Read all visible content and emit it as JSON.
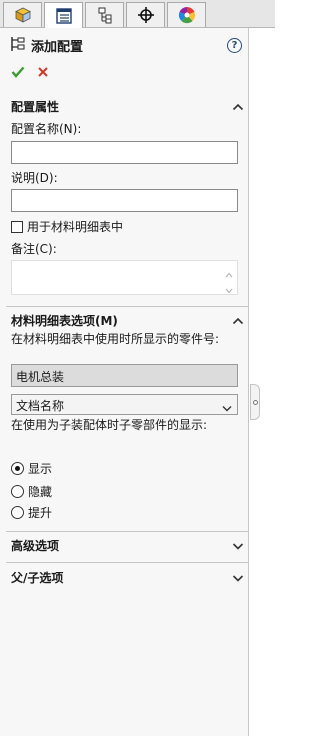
{
  "tabs": [
    {
      "name": "feature-manager",
      "icon": "part-cube-icon",
      "active": false
    },
    {
      "name": "property-manager",
      "icon": "property-list-icon",
      "active": true
    },
    {
      "name": "configuration-manager",
      "icon": "configuration-tree-icon",
      "active": false
    },
    {
      "name": "dimxpert-manager",
      "icon": "crosshair-target-icon",
      "active": false
    },
    {
      "name": "display-manager",
      "icon": "color-wheel-icon",
      "active": false
    }
  ],
  "header": {
    "title": "添加配置",
    "icon": "add-configuration-icon",
    "help_icon": "?"
  },
  "actions": {
    "ok": "check-icon",
    "cancel": "x-icon",
    "ok_color": "#3a9e2e",
    "cancel_color": "#d13a2a"
  },
  "config_props": {
    "heading": "配置属性",
    "name_label": "配置名称(N):",
    "name_value": "",
    "desc_label": "说明(D):",
    "desc_value": "",
    "use_in_bom_label": "用于材料明细表中",
    "use_in_bom_checked": false,
    "comment_label": "备注(C):",
    "comment_value": ""
  },
  "bom_options": {
    "heading": "材料明细表选项(M)",
    "part_number_label": "在材料明细表中使用时所显示的零件号:",
    "part_number_value": "电机总装",
    "source_select": "文档名称",
    "child_display_label": "在使用为子装配体时子零部件的显示:",
    "radios": [
      {
        "label": "显示",
        "selected": true
      },
      {
        "label": "隐藏",
        "selected": false
      },
      {
        "label": "提升",
        "selected": false
      }
    ]
  },
  "advanced": {
    "heading": "高级选项"
  },
  "parent_child": {
    "heading": "父/子选项"
  }
}
